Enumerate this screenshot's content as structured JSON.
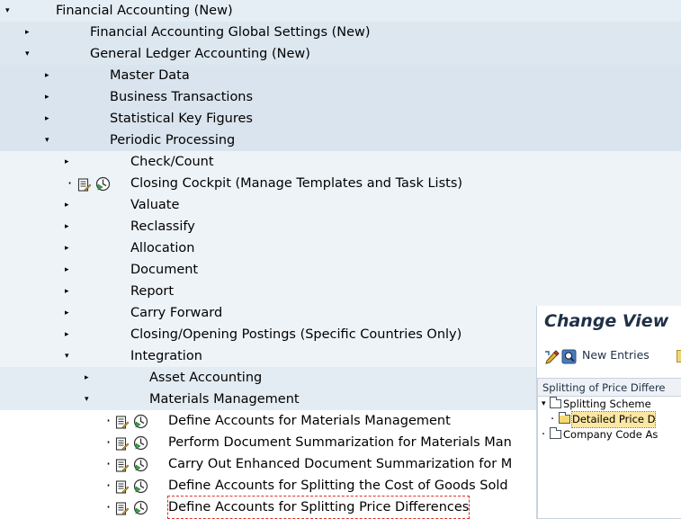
{
  "tree": [
    {
      "label": "Financial Accounting (New)",
      "level": 0,
      "expander": "down"
    },
    {
      "label": "Financial Accounting Global Settings (New)",
      "level": 1,
      "expander": "right"
    },
    {
      "label": "General Ledger Accounting (New)",
      "level": 1,
      "expander": "down"
    },
    {
      "label": "Master Data",
      "level": 2,
      "expander": "right"
    },
    {
      "label": "Business Transactions",
      "level": 2,
      "expander": "right"
    },
    {
      "label": "Statistical Key Figures",
      "level": 2,
      "expander": "right"
    },
    {
      "label": "Periodic Processing",
      "level": 2,
      "expander": "down"
    },
    {
      "label": "Check/Count",
      "level": 3,
      "expander": "right"
    },
    {
      "label": "Closing Cockpit (Manage Templates and Task Lists)",
      "level": 3,
      "expander": "leaf"
    },
    {
      "label": "Valuate",
      "level": 3,
      "expander": "right"
    },
    {
      "label": "Reclassify",
      "level": 3,
      "expander": "right"
    },
    {
      "label": "Allocation",
      "level": 3,
      "expander": "right"
    },
    {
      "label": "Document",
      "level": 3,
      "expander": "right"
    },
    {
      "label": "Report",
      "level": 3,
      "expander": "right"
    },
    {
      "label": "Carry Forward",
      "level": 3,
      "expander": "right"
    },
    {
      "label": "Closing/Opening Postings (Specific Countries Only)",
      "level": 3,
      "expander": "right"
    },
    {
      "label": "Integration",
      "level": 3,
      "expander": "down"
    },
    {
      "label": "Asset Accounting",
      "level": 4,
      "expander": "right"
    },
    {
      "label": "Materials Management",
      "level": 4,
      "expander": "down"
    },
    {
      "label": "Define Accounts for Materials Management",
      "level": 5,
      "expander": "leaf"
    },
    {
      "label": "Perform Document Summarization for Materials Man",
      "level": 5,
      "expander": "leaf"
    },
    {
      "label": "Carry Out Enhanced Document Summarization for M",
      "level": 5,
      "expander": "leaf"
    },
    {
      "label": "Define Accounts for Splitting the Cost of Goods Sold",
      "level": 5,
      "expander": "leaf"
    },
    {
      "label": "Define Accounts for Splitting Price Differences",
      "level": 5,
      "expander": "leaf",
      "selected": true
    }
  ],
  "panel": {
    "title": "Change View",
    "toolbar": {
      "new_entries_label": "New Entries",
      "icons": [
        "change-display-icon",
        "find-icon",
        "copy-icon"
      ]
    },
    "tree_header": "Splitting of Price Differe",
    "tree": [
      {
        "label": "Splitting Scheme",
        "level": 0,
        "expander": "down",
        "icon": "folder-icon"
      },
      {
        "label": "Detailed Price D",
        "level": 1,
        "expander": "leaf",
        "icon": "folder-open-icon",
        "selected": true
      },
      {
        "label": "Company Code As",
        "level": 0,
        "expander": "leaf",
        "icon": "folder-icon"
      }
    ]
  },
  "colors": {
    "text": "#000000",
    "band_level0": "#e6eef5",
    "band_level2": "#d9e4ee",
    "selection_outline": "#d9342b",
    "title": "#1f3047"
  }
}
